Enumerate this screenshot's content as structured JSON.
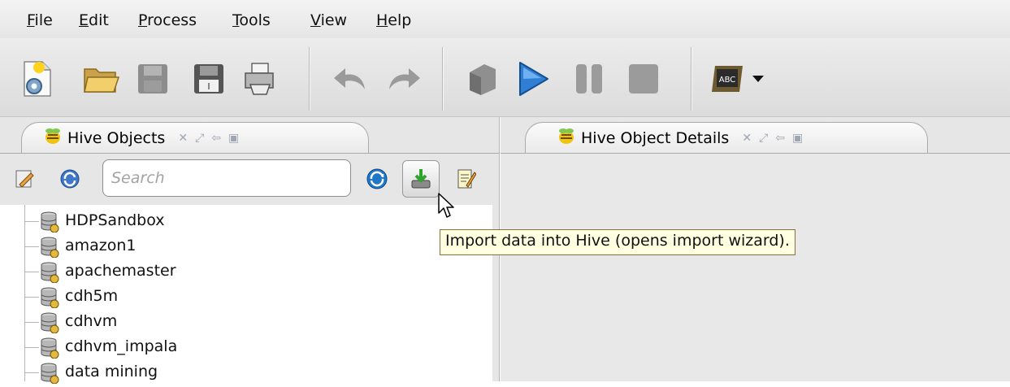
{
  "menu": {
    "items": [
      {
        "mnemonic": "F",
        "rest": "ile"
      },
      {
        "mnemonic": "E",
        "rest": "dit"
      },
      {
        "mnemonic": "P",
        "rest": "rocess"
      },
      {
        "mnemonic": "T",
        "rest": "ools"
      },
      {
        "mnemonic": "V",
        "rest": "iew"
      },
      {
        "mnemonic": "H",
        "rest": "elp"
      }
    ]
  },
  "toolbar": {
    "icons": [
      "new-document-icon",
      "open-folder-icon",
      "save-icon",
      "save-as-icon",
      "print-icon",
      "undo-icon",
      "redo-icon",
      "stop-icon",
      "run-icon",
      "pause-icon",
      "terminate-icon",
      "spellcheck-icon",
      "dropdown-arrow-icon"
    ],
    "spellcheck_label": "ABC"
  },
  "left_pane": {
    "tab_title": "Hive Objects",
    "search": {
      "placeholder": "Search",
      "value": ""
    },
    "tree": [
      "HDPSandbox",
      "amazon1",
      "apachemaster",
      "cdh5m",
      "cdhvm",
      "cdhvm_impala",
      "data mining"
    ]
  },
  "right_pane": {
    "tab_title": "Hive Object Details"
  },
  "tooltip": {
    "text": "Import data into Hive (opens import wizard)."
  },
  "colors": {
    "accent_blue": "#2f7fd6",
    "tooltip_bg": "#ffffe1"
  }
}
